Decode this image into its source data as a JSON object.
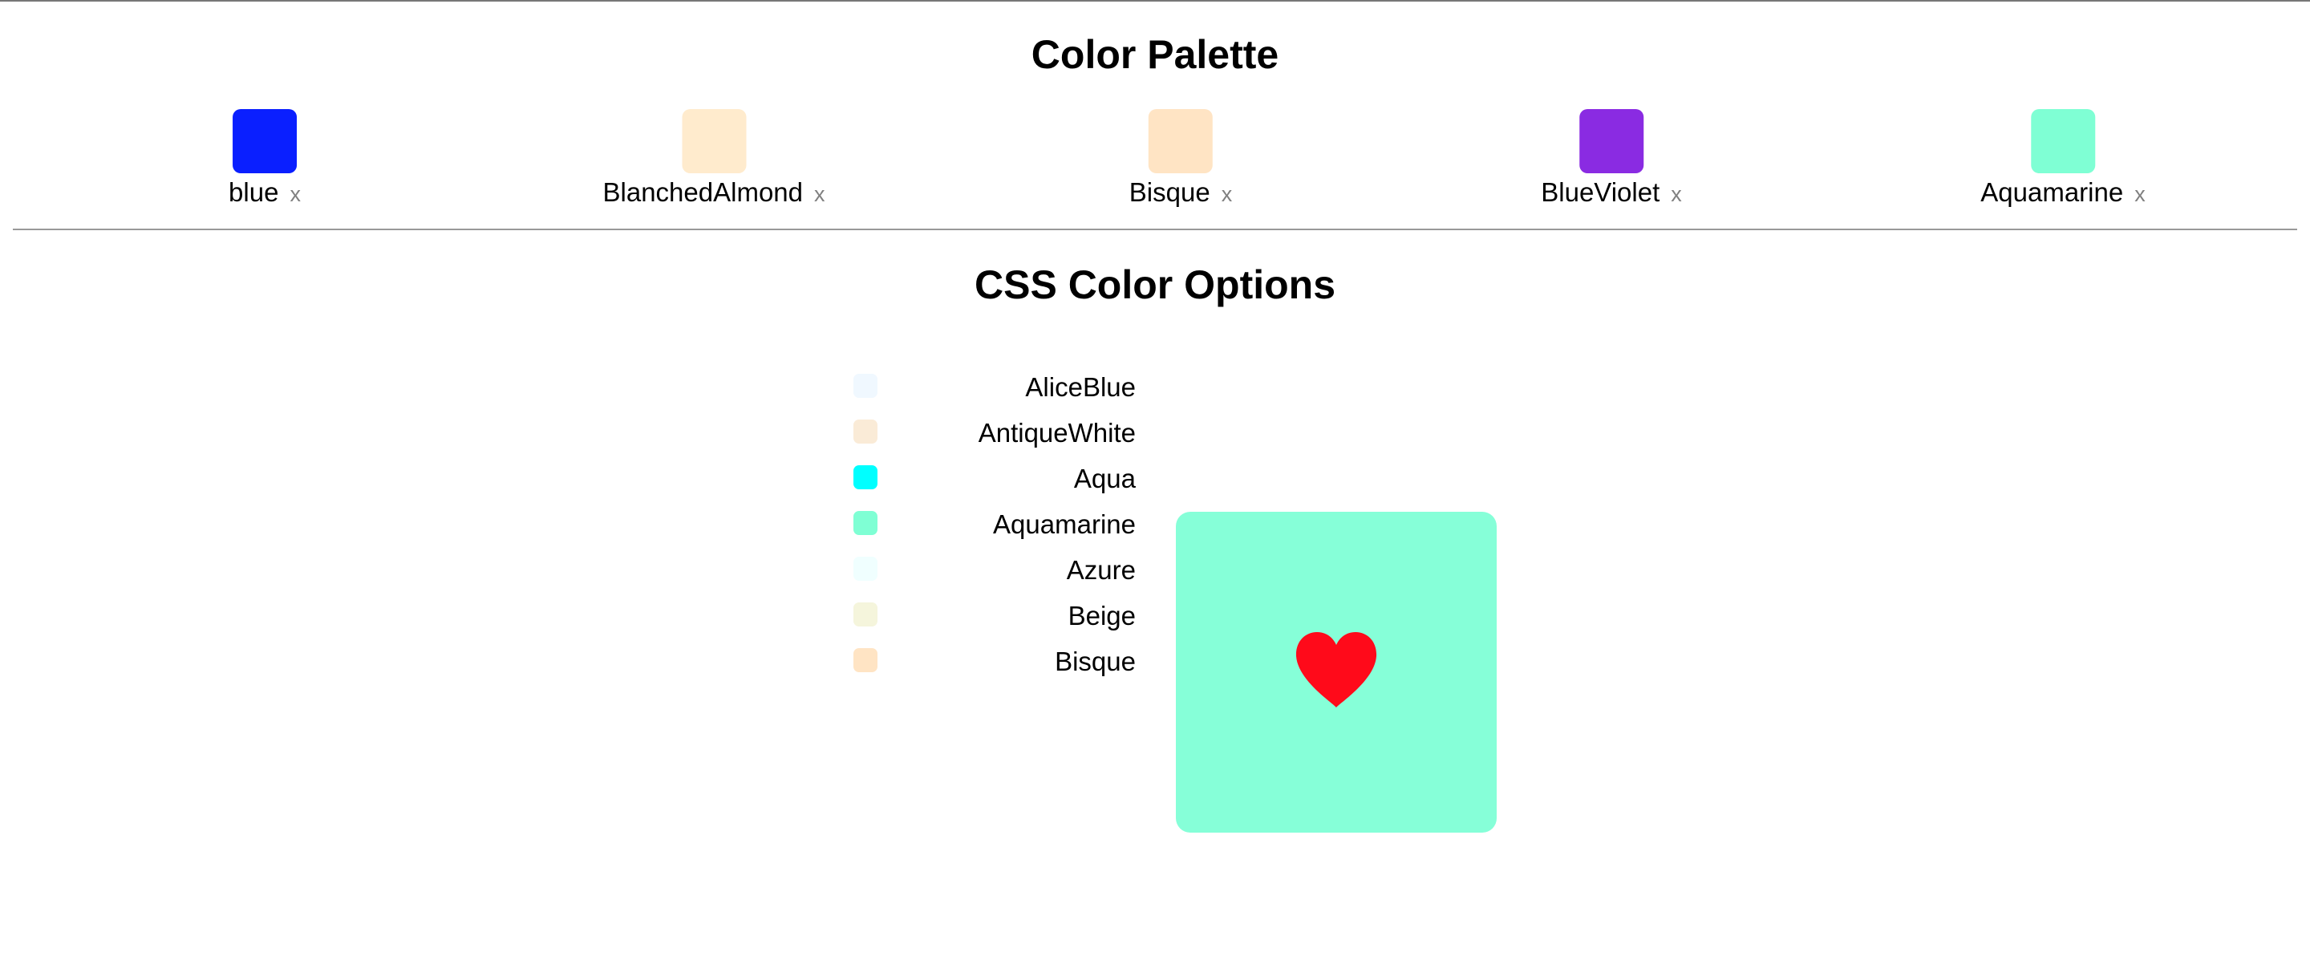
{
  "palette": {
    "title": "Color Palette",
    "remove_label": "x",
    "items": [
      {
        "name": "blue",
        "color": "#0a1fff"
      },
      {
        "name": "BlanchedAlmond",
        "color": "#ffebcd"
      },
      {
        "name": "Bisque",
        "color": "#ffe4c4"
      },
      {
        "name": "BlueViolet",
        "color": "#8a2be2"
      },
      {
        "name": "Aquamarine",
        "color": "#7fffd4"
      }
    ]
  },
  "options": {
    "title": "CSS Color Options",
    "items": [
      {
        "name": "AliceBlue",
        "color": "#f0f8ff"
      },
      {
        "name": "AntiqueWhite",
        "color": "#faebd7"
      },
      {
        "name": "Aqua",
        "color": "#00ffff"
      },
      {
        "name": "Aquamarine",
        "color": "#7fffd4"
      },
      {
        "name": "Azure",
        "color": "#f0ffff"
      },
      {
        "name": "Beige",
        "color": "#f5f5dc"
      },
      {
        "name": "Bisque",
        "color": "#ffe4c4"
      }
    ]
  },
  "preview": {
    "background_color": "#86ffd8",
    "icon": "heart-icon",
    "icon_color": "#ff0a1a"
  }
}
